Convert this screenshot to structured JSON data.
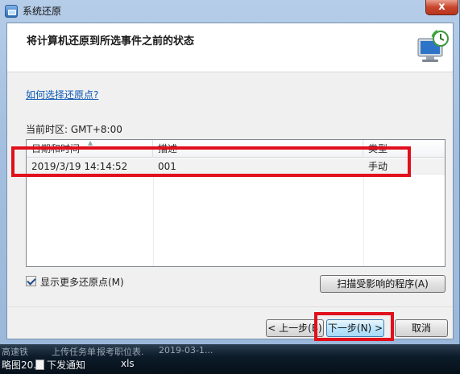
{
  "window": {
    "title": "系统还原",
    "close_label": "x"
  },
  "header": {
    "title": "将计算机还原到所选事件之前的状态"
  },
  "help_link": "如何选择还原点?",
  "timezone_label": "当前时区: GMT+8:00",
  "restore_points": {
    "columns": [
      "日期和时间",
      "描述",
      "类型"
    ],
    "rows": [
      {
        "datetime": "2019/3/19 14:14:52",
        "description": "001",
        "type": "手动"
      }
    ]
  },
  "show_more_checkbox": {
    "label": "显示更多还原点(M)",
    "checked": true
  },
  "buttons": {
    "scan": "扫描受影响的程序(A)",
    "back": "< 上一步(B)",
    "next": "下一步(N) >",
    "cancel": "取消"
  },
  "taskbar": {
    "line1": [
      "高速铁",
      "上传任务单",
      "报考职位表.",
      "2019-03-1..."
    ],
    "line2": [
      "略图20...",
      "下发通知",
      "xls"
    ]
  },
  "colors": {
    "annotation": "#e0101c",
    "link": "#0b58b5"
  }
}
